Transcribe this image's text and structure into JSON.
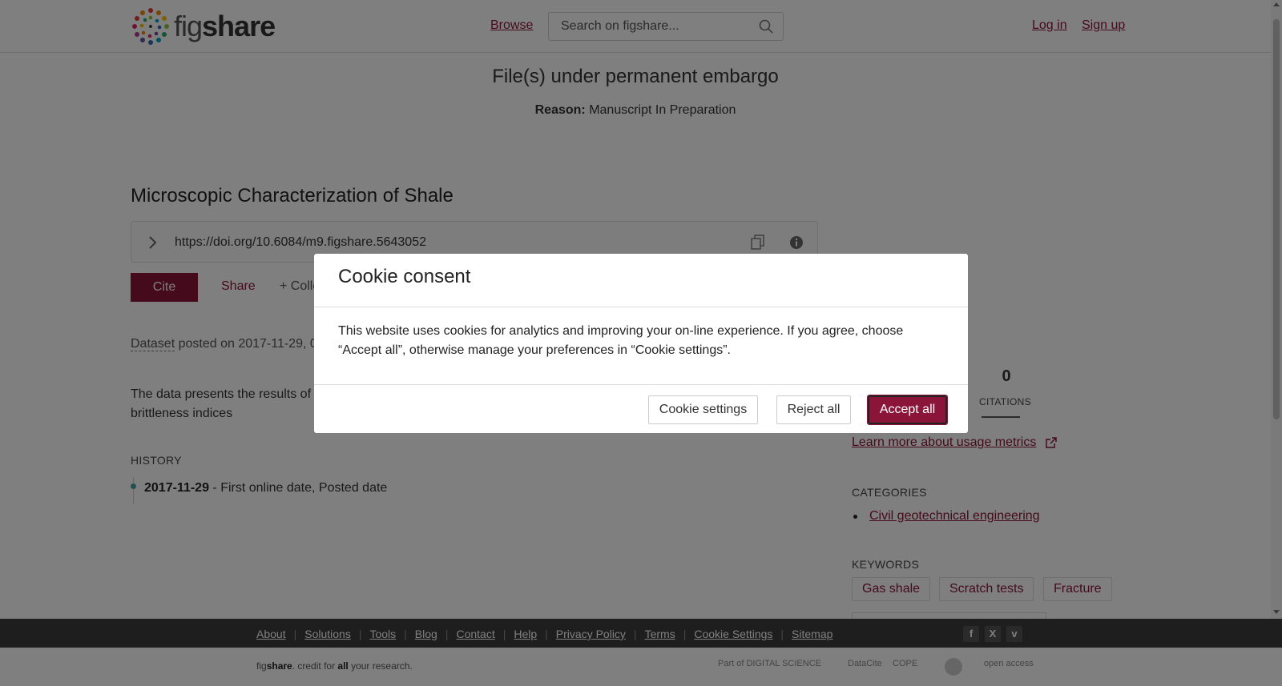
{
  "header": {
    "logo_text_light": "fig",
    "logo_text_bold": "share",
    "browse": "Browse",
    "search_placeholder": "Search on figshare...",
    "login": "Log in",
    "signup": "Sign up"
  },
  "embargo": {
    "title": "File(s) under permanent embargo",
    "reason_label": "Reason:",
    "reason_value": "Manuscript In Preparation"
  },
  "item": {
    "title": "Microscopic Characterization of Shale",
    "doi": "https://doi.org/10.6084/m9.figshare.5643052",
    "cite": "Cite",
    "share": "Share",
    "collect": "+ Colle",
    "type": "Dataset",
    "posted": " posted on 2017-11-29, 0",
    "description": "The data presents the results of fracture using brittleness indices"
  },
  "history": {
    "heading": "HISTORY",
    "date": "2017-11-29",
    "event": " - First online date, Posted date"
  },
  "metrics": {
    "citations_value": "0",
    "citations_label": "CITATIONS",
    "learn_more": "Learn more about usage metrics"
  },
  "categories": {
    "heading": "CATEGORIES",
    "items": [
      "Civil geotechnical engineering"
    ]
  },
  "keywords": {
    "heading": "KEYWORDS",
    "items": [
      "Gas shale",
      "Scratch tests",
      "Fracture"
    ]
  },
  "footer": {
    "links": [
      "About",
      "Solutions",
      "Tools",
      "Blog",
      "Contact",
      "Help",
      "Privacy Policy",
      "Terms",
      "Cookie Settings",
      "Sitemap"
    ],
    "tagline_pre": "fig",
    "tagline_bold": "share",
    "tagline_mid": ". credit for ",
    "tagline_all": "all",
    "tagline_post": " your research.",
    "partners": [
      "Part of DIGITAL SCIENCE",
      "DataCite",
      "COPE",
      "open access"
    ]
  },
  "modal": {
    "title": "Cookie consent",
    "body": "This website uses cookies for analytics and improving your on-line experience. If you agree, choose “Accept all”, otherwise manage your preferences in “Cookie settings”.",
    "settings": "Cookie settings",
    "reject": "Reject all",
    "accept": "Accept all"
  },
  "colors": {
    "brand": "#8a1538",
    "overlay": "rgba(0,0,0,0.5)",
    "footer": "#3c3c3c"
  }
}
